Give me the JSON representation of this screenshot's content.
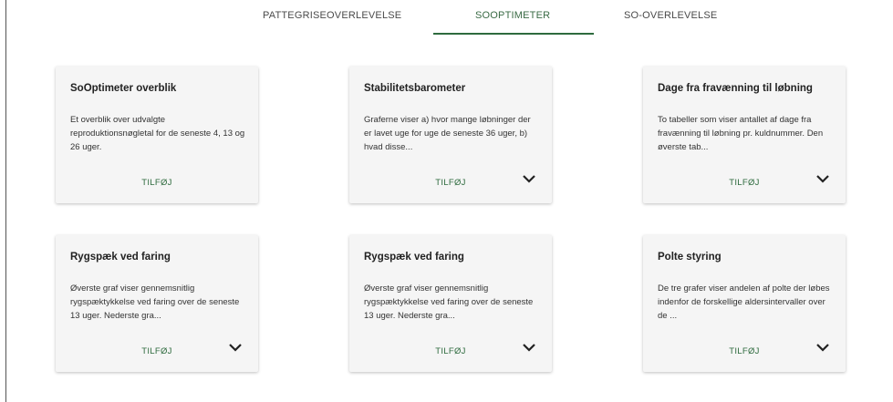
{
  "tabs": [
    {
      "label": "PATTEGRISEOVERLEVELSE"
    },
    {
      "label": "SOOPTIMETER"
    },
    {
      "label": "SO-OVERLEVELSE"
    }
  ],
  "cards": [
    {
      "title": "SoOptimeter overblik",
      "description": "Et overblik over udvalgte reproduktionsnøgletal for de seneste 4, 13 og 26 uger.",
      "add_label": "TILFØJ",
      "expand_icon": "chevron-down-icon"
    },
    {
      "title": "Stabilitetsbarometer",
      "description": "Graferne viser a) hvor mange løbninger der er lavet uge for uge de seneste 36 uger, b) hvad disse...",
      "add_label": "TILFØJ",
      "expand_icon": "chevron-down-icon"
    },
    {
      "title": "Dage fra fravænning til løbning",
      "description": "To tabeller som viser antallet af dage fra fravænning til løbning pr. kuldnummer. Den øverste tab...",
      "add_label": "TILFØJ",
      "expand_icon": "chevron-down-icon"
    },
    {
      "title": "Rygspæk ved faring",
      "description": "Øverste graf viser gennemsnitlig rygspæktykkelse ved faring over de seneste 13 uger. Nederste gra...",
      "add_label": "TILFØJ",
      "expand_icon": "chevron-down-icon"
    },
    {
      "title": "Rygspæk ved faring",
      "description": "Øverste graf viser gennemsnitlig rygspæktykkelse ved faring over de seneste 13 uger. Nederste gra...",
      "add_label": "TILFØJ",
      "expand_icon": "chevron-down-icon"
    },
    {
      "title": "Polte styring",
      "description": "De tre grafer viser andelen af polte der løbes indenfor de forskellige aldersintervaller over de ...",
      "add_label": "TILFØJ",
      "expand_icon": "chevron-down-icon"
    }
  ],
  "colors": {
    "accent": "#2e6b3e",
    "card_background": "#f5f5f5"
  }
}
